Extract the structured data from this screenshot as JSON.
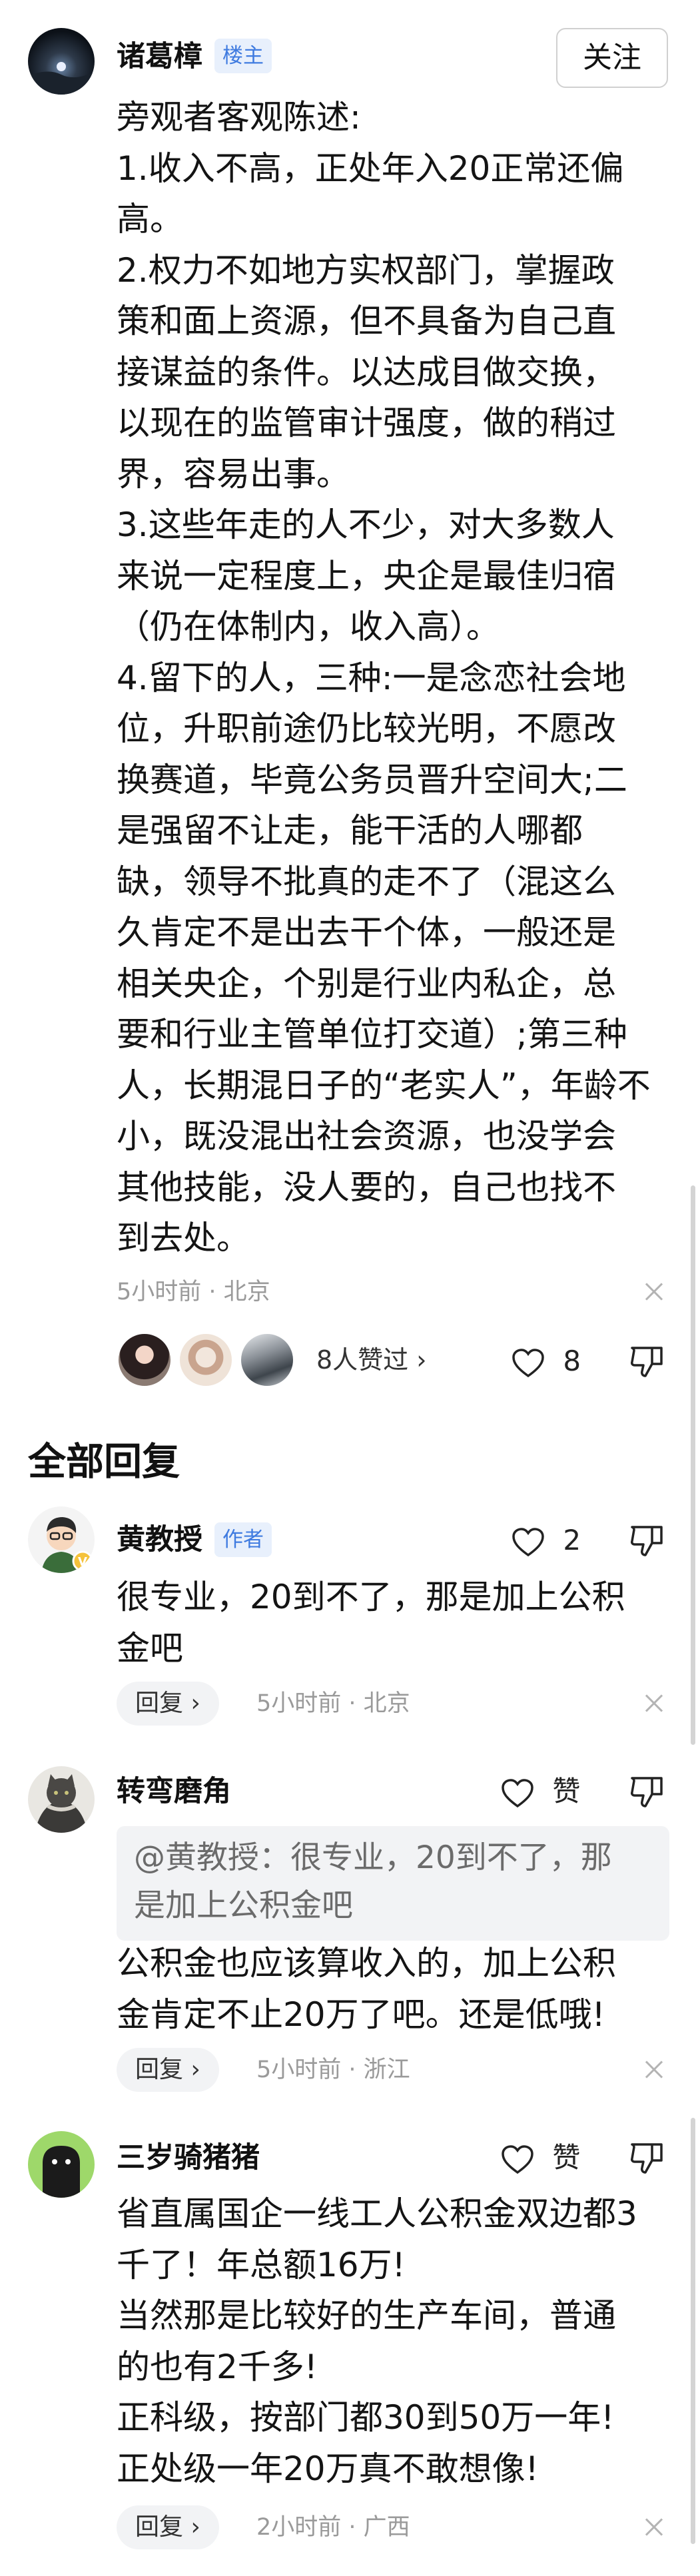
{
  "op_comment": {
    "author": "诸葛樟",
    "tag": "楼主",
    "follow_label": "关注",
    "lines": [
      "旁观者客观陈述:",
      "1.收入不高，正处年入20正常还偏",
      "高。",
      "2.权力不如地方实权部门，掌握政",
      "策和面上资源，但不具备为自己直",
      "接谋益的条件。以达成目做交换，",
      "以现在的监管审计强度，做的稍过",
      "界，容易出事。",
      "3.这些年走的人不少，对大多数人",
      "来说一定程度上，央企是最佳归宿",
      "（仍在体制内，收入高）。",
      "4.留下的人，三种:一是念恋社会地",
      "位，升职前途仍比较光明，不愿改",
      "换赛道，毕竟公务员晋升空间大;二",
      "是强留不让走，能干活的人哪都",
      "缺，领导不批真的走不了（混这么",
      "久肯定不是出去干个体，一般还是",
      "相关央企，个别是行业内私企，总",
      "要和行业主管单位打交道）;第三种",
      "人，长期混日子的“老实人”，年龄不",
      "小，既没混出社会资源，也没学会",
      "其他技能，没人要的，自己也找不",
      "到去处。"
    ],
    "meta": "5小时前 · 北京",
    "likers_text": "8人赞过 ›",
    "like_count": "8"
  },
  "section_title": "全部回复",
  "replies": [
    {
      "author": "黄教授",
      "tag": "作者",
      "like_label": "2",
      "lines": [
        "很专业，20到不了，那是加上公积",
        "金吧"
      ],
      "reply_label": "回复 ›",
      "meta": "5小时前 · 北京"
    },
    {
      "author": "转弯磨角",
      "like_label": "赞",
      "quote_lines": [
        "@黄教授：很专业，20到不了，那",
        "是加上公积金吧"
      ],
      "lines": [
        "公积金也应该算收入的，加上公积",
        "金肯定不止20万了吧。还是低哦!"
      ],
      "reply_label": "回复 ›",
      "meta": "5小时前 · 浙江"
    },
    {
      "author": "三岁骑猪猪",
      "like_label": "赞",
      "lines": [
        "省直属国企一线工人公积金双边都3",
        "千了！年总额16万!",
        "当然那是比较好的生产车间，普通",
        "的也有2千多!",
        "正科级，按部门都30到50万一年!",
        "正处级一年20万真不敢想像!"
      ],
      "reply_label": "回复 ›",
      "meta": "2小时前 · 广西"
    }
  ],
  "colors": {
    "text": "#141414",
    "meta": "#9a9a9a",
    "tag_text": "#3f7be0",
    "tag_bg": "#e8f0fc",
    "pill_bg": "#f2f3f5"
  }
}
